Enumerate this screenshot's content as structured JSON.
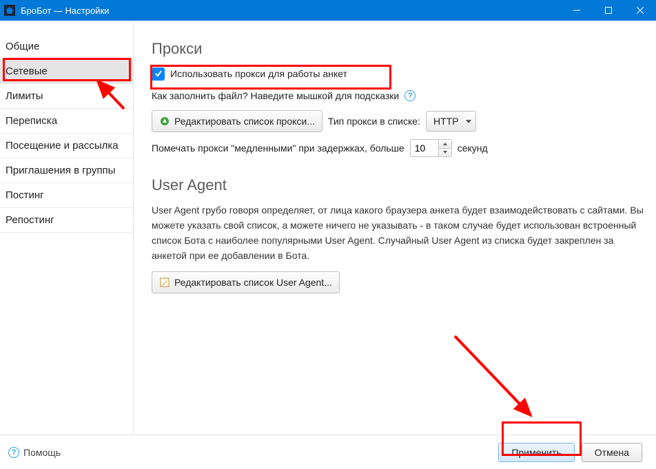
{
  "window": {
    "title": "БроБот — Настройки"
  },
  "sidebar": {
    "items": [
      {
        "label": "Общие"
      },
      {
        "label": "Сетевые"
      },
      {
        "label": "Лимиты"
      },
      {
        "label": "Переписка"
      },
      {
        "label": "Посещение и рассылка"
      },
      {
        "label": "Приглашения в группы"
      },
      {
        "label": "Постинг"
      },
      {
        "label": "Репостинг"
      }
    ],
    "selected_index": 1
  },
  "proxy": {
    "section_title": "Прокси",
    "use_proxy_label": "Использовать прокси для работы анкет",
    "fill_file_hint": "Как заполнить файл? Наведите мышкой для подсказки",
    "edit_proxy_list_btn": "Редактировать список прокси...",
    "proxy_type_label": "Тип прокси в списке:",
    "proxy_type_value": "HTTP",
    "mark_slow_prefix": "Помечать прокси \"медленными\" при задержках, больше",
    "delay_seconds": "10",
    "seconds_suffix": "секунд"
  },
  "user_agent": {
    "section_title": "User Agent",
    "description": "User Agent грубо говоря определяет, от лица какого браузера анкета будет взаимодействовать с сайтами. Вы можете указать свой список, а можете ничего не указывать - в таком случае будет использован встроенный список Бота с наиболее популярными User Agent. Случайный User Agent из списка будет закреплен за анкетой при ее добавлении в Бота.",
    "edit_ua_list_btn": "Редактировать список User Agent..."
  },
  "footer": {
    "help_label": "Помощь",
    "apply_label": "Применить",
    "cancel_label": "Отмена"
  }
}
